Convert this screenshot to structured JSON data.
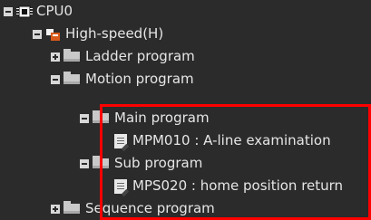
{
  "tree": {
    "cpu": {
      "label": "CPU0",
      "icon": "cpu-chip-icon"
    },
    "high_speed": {
      "label": "High-speed(H)",
      "icon": "high-speed-task-icon"
    },
    "ladder": {
      "label": "Ladder program",
      "icon": "folder-icon"
    },
    "motion": {
      "label": "Motion program",
      "icon": "folder-icon"
    },
    "main_program": {
      "label": "Main program",
      "icon": "folder-icon"
    },
    "mpm010": {
      "label": "MPM010 : A-line examination",
      "icon": "program-document-icon"
    },
    "sub_program": {
      "label": "Sub program",
      "icon": "folder-icon"
    },
    "mps020": {
      "label": "MPS020 : home position return",
      "icon": "program-document-icon"
    },
    "sequence": {
      "label": "Sequence program",
      "icon": "folder-icon"
    }
  },
  "highlight": {
    "color": "#ff0000"
  }
}
